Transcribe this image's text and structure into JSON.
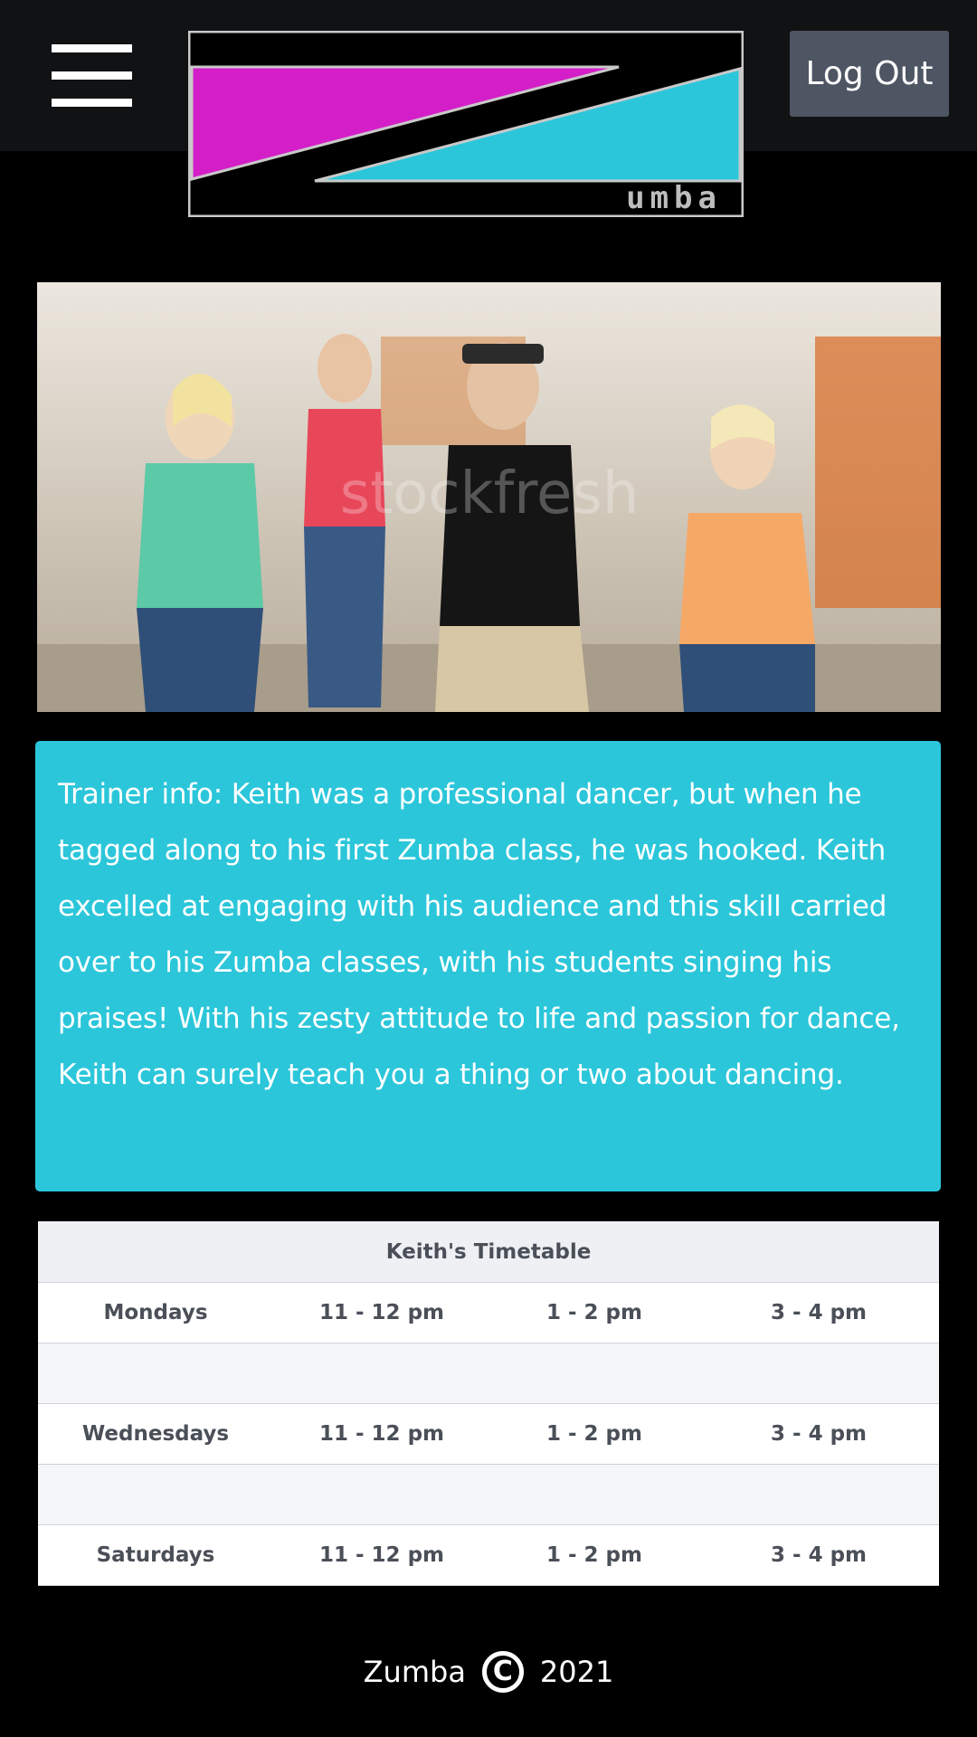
{
  "header": {
    "menu_icon": "hamburger-menu-icon",
    "logo_text": "umba",
    "logout_label": "Log Out"
  },
  "hero": {
    "watermark": "stockfresh"
  },
  "trainer": {
    "info": "Trainer info: Keith was a professional dancer, but when he tagged along to his first Zumba class, he was hooked. Keith excelled at engaging with his audience and this skill carried over to his Zumba classes, with his students singing his praises! With his zesty attitude to life and passion for dance, Keith can surely teach you a thing or two about dancing."
  },
  "timetable": {
    "title": "Keith's Timetable",
    "rows": [
      {
        "day": "Mondays",
        "slots": [
          "11 - 12 pm",
          "1 - 2 pm",
          "3 - 4 pm"
        ]
      },
      {
        "day": "Wednesdays",
        "slots": [
          "11 - 12 pm",
          "1 - 2 pm",
          "3 - 4 pm"
        ]
      },
      {
        "day": "Saturdays",
        "slots": [
          "11 - 12 pm",
          "1 - 2 pm",
          "3 - 4 pm"
        ]
      }
    ]
  },
  "footer": {
    "brand": "Zumba",
    "copyright_symbol": "C",
    "year": "2021"
  },
  "colors": {
    "accent_cyan": "#2bc6da",
    "logo_magenta": "#d41ec8",
    "topbar": "#111214",
    "button": "#4e5563"
  }
}
